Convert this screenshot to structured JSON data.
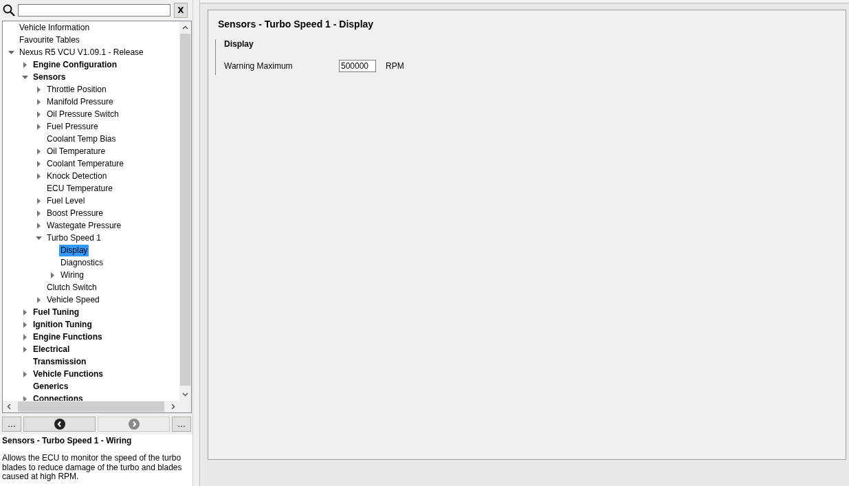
{
  "search": {
    "clear_label": "X"
  },
  "tree": [
    {
      "label": "Vehicle Information",
      "kind": "leaf",
      "selected": false
    },
    {
      "label": "Favourite Tables",
      "kind": "leaf",
      "selected": false
    },
    {
      "label": "Nexus R5 VCU V1.09.1 - Release",
      "kind": "branch",
      "expanded": true,
      "selected": false,
      "children": [
        {
          "label": "Engine Configuration",
          "kind": "branch",
          "expanded": false,
          "selected": false
        },
        {
          "label": "Sensors",
          "kind": "branch",
          "expanded": true,
          "selected": false,
          "children": [
            {
              "label": "Throttle Position",
              "kind": "branch",
              "expanded": false,
              "selected": false
            },
            {
              "label": "Manifold Pressure",
              "kind": "branch",
              "expanded": false,
              "selected": false
            },
            {
              "label": "Oil Pressure Switch",
              "kind": "branch",
              "expanded": false,
              "selected": false
            },
            {
              "label": "Fuel Pressure",
              "kind": "branch",
              "expanded": false,
              "selected": false
            },
            {
              "label": "Coolant Temp Bias",
              "kind": "leaf",
              "selected": false
            },
            {
              "label": "Oil Temperature",
              "kind": "branch",
              "expanded": false,
              "selected": false
            },
            {
              "label": "Coolant Temperature",
              "kind": "branch",
              "expanded": false,
              "selected": false
            },
            {
              "label": "Knock Detection",
              "kind": "branch",
              "expanded": false,
              "selected": false
            },
            {
              "label": "ECU Temperature",
              "kind": "leaf",
              "selected": false
            },
            {
              "label": "Fuel Level",
              "kind": "branch",
              "expanded": false,
              "selected": false
            },
            {
              "label": "Boost Pressure",
              "kind": "branch",
              "expanded": false,
              "selected": false
            },
            {
              "label": "Wastegate Pressure",
              "kind": "branch",
              "expanded": false,
              "selected": false
            },
            {
              "label": "Turbo Speed 1",
              "kind": "branch",
              "expanded": true,
              "selected": false,
              "children": [
                {
                  "label": "Display",
                  "kind": "leaf",
                  "selected": true
                },
                {
                  "label": "Diagnostics",
                  "kind": "leaf",
                  "selected": false
                },
                {
                  "label": "Wiring",
                  "kind": "branch",
                  "expanded": false,
                  "selected": false
                }
              ]
            },
            {
              "label": "Clutch Switch",
              "kind": "leaf",
              "selected": false
            },
            {
              "label": "Vehicle Speed",
              "kind": "branch",
              "expanded": false,
              "selected": false
            }
          ]
        },
        {
          "label": "Fuel Tuning",
          "kind": "branch",
          "expanded": false,
          "selected": false
        },
        {
          "label": "Ignition Tuning",
          "kind": "branch",
          "expanded": false,
          "selected": false
        },
        {
          "label": "Engine Functions",
          "kind": "branch",
          "expanded": false,
          "selected": false
        },
        {
          "label": "Electrical",
          "kind": "branch",
          "expanded": false,
          "selected": false
        },
        {
          "label": "Transmission",
          "kind": "leaf",
          "selected": false
        },
        {
          "label": "Vehicle Functions",
          "kind": "branch",
          "expanded": false,
          "selected": false
        },
        {
          "label": "Generics",
          "kind": "leaf",
          "selected": false
        },
        {
          "label": "Connections",
          "kind": "branch",
          "expanded": false,
          "selected": false
        }
      ]
    }
  ],
  "nav": {
    "first_label": "...",
    "last_label": "...",
    "back_enabled": true,
    "forward_enabled": false
  },
  "description": {
    "title": "Sensors - Turbo Speed 1 - Wiring",
    "text": "Allows the ECU to monitor the speed of the turbo blades to reduce damage of the turbo and blades caused at high RPM."
  },
  "page": {
    "title": "Sensors - Turbo Speed 1 - Display",
    "section": "Display",
    "fields": [
      {
        "label": "Warning Maximum",
        "value": "500000",
        "unit": "RPM"
      }
    ]
  }
}
